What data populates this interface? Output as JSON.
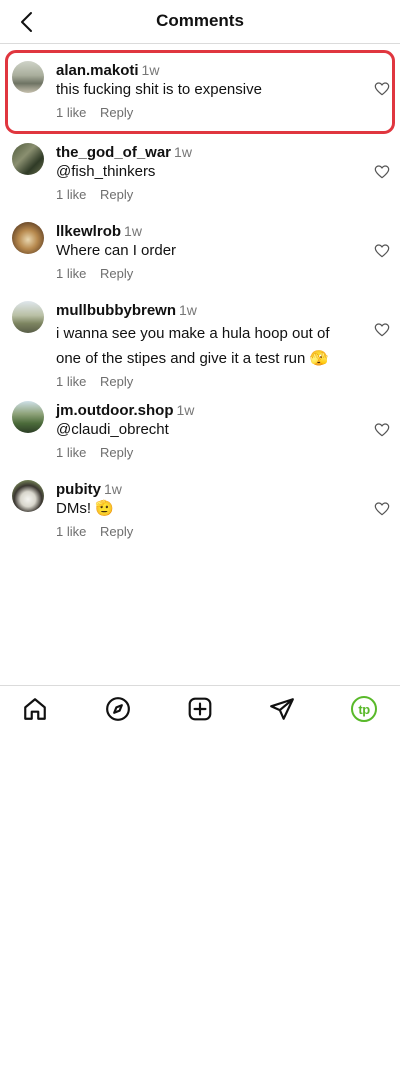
{
  "header": {
    "title": "Comments"
  },
  "icons": {
    "back": "chevron-left-icon",
    "like": "heart-outline-icon",
    "home": "home-icon",
    "explore": "compass-icon",
    "create": "plus-square-icon",
    "messages": "send-icon",
    "profile": "tp-avatar-icon"
  },
  "colors": {
    "highlight_border": "#e0363f",
    "profile_accent": "#59b92a"
  },
  "comments": [
    {
      "username": "alan.makoti",
      "age": "1w",
      "text": "this fucking shit is to expensive",
      "likes": "1 like",
      "reply": "Reply"
    },
    {
      "username": "the_god_of_war",
      "age": "1w",
      "text": "@fish_thinkers",
      "likes": "1 like",
      "reply": "Reply"
    },
    {
      "username": "llkewlrob",
      "age": "1w",
      "text": "Where can I order",
      "likes": "1 like",
      "reply": "Reply"
    },
    {
      "username": "mullbubbybrewn",
      "age": "1w",
      "text": "i wanna see you make a hula hoop out of one of the stipes and give it a test run 🫣",
      "likes": "1 like",
      "reply": "Reply"
    },
    {
      "username": "jm.outdoor.shop",
      "age": "1w",
      "text": "@claudi_obrecht",
      "likes": "1 like",
      "reply": "Reply"
    },
    {
      "username": "pubity",
      "age": "1w",
      "text": "DMs! 🫡",
      "likes": "1 like",
      "reply": "Reply"
    }
  ],
  "tabbar": {
    "profile_initials": "tp"
  }
}
